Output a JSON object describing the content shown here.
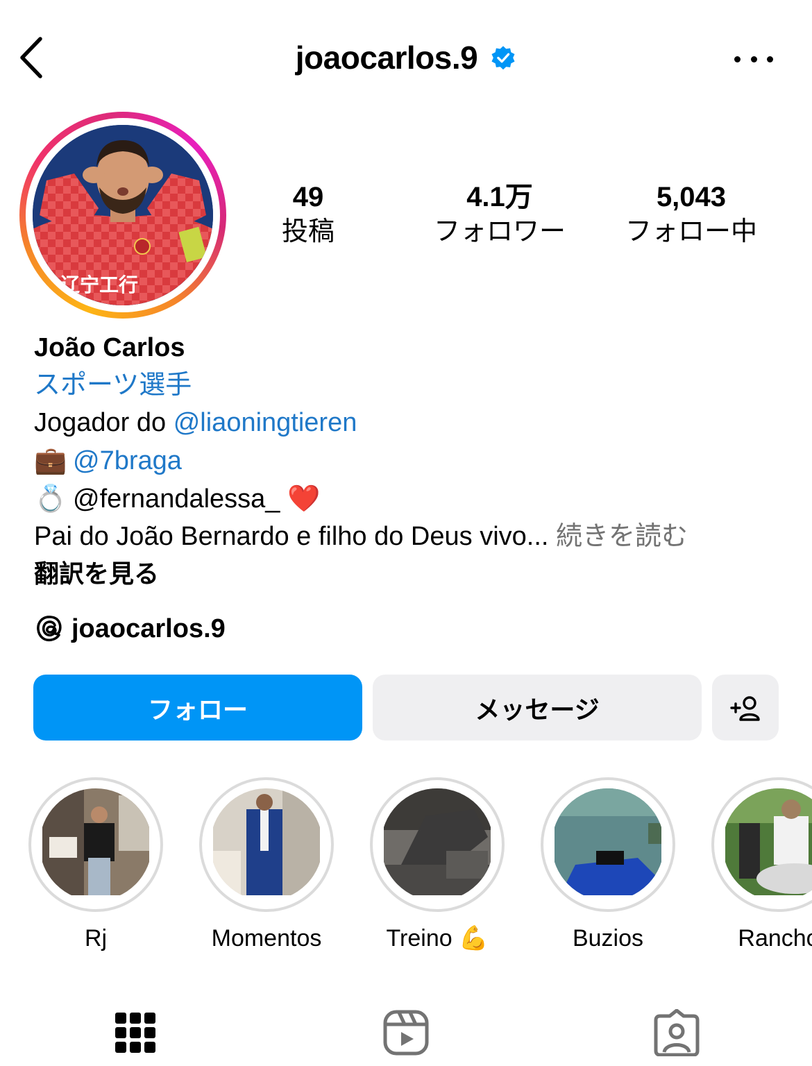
{
  "header": {
    "username": "joaocarlos.9",
    "verified": true,
    "back_icon": "chevron-left-icon",
    "more_icon": "more-horizontal-icon"
  },
  "stats": [
    {
      "value": "49",
      "label": "投稿"
    },
    {
      "value": "4.1万",
      "label": "フォロワー"
    },
    {
      "value": "5,043",
      "label": "フォロー中"
    }
  ],
  "bio": {
    "name": "João Carlos",
    "category": "スポーツ選手",
    "line1_text": "Jogador do ",
    "line1_mention": "@liaoningtieren",
    "line2_emoji": "💼",
    "line2_mention": "@7braga",
    "line3_emoji": "💍",
    "line3_text": "@fernandalessa_",
    "line3_emoji_end": "❤️",
    "line4_text": "Pai do João Bernardo e filho do Deus vivo...",
    "read_more": "続きを読む",
    "translate": "翻訳を見る"
  },
  "threads": {
    "icon": "threads-icon",
    "handle": "joaocarlos.9"
  },
  "actions": {
    "follow": "フォロー",
    "message": "メッセージ",
    "add_user_icon": "add-user-icon"
  },
  "highlights": [
    {
      "label": "Rj"
    },
    {
      "label": "Momentos"
    },
    {
      "label": "Treino 💪"
    },
    {
      "label": "Buzios"
    },
    {
      "label": "Rancho"
    }
  ],
  "tabs": [
    {
      "icon": "grid-icon",
      "selected": true
    },
    {
      "icon": "reels-icon",
      "selected": false
    },
    {
      "icon": "tagged-icon",
      "selected": false
    }
  ],
  "colors": {
    "primary": "#0095f6",
    "link": "#1f78c8",
    "verified": "#0095f6",
    "secondary_btn": "#efeff1",
    "muted": "#737373"
  }
}
